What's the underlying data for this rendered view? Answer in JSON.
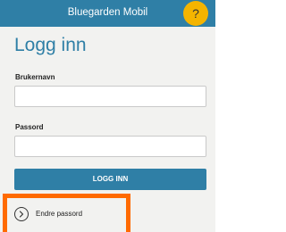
{
  "header": {
    "title": "Bluegarden Mobil",
    "help_label": "?"
  },
  "login": {
    "title": "Logg inn",
    "username_label": "Brukernavn",
    "username_value": "",
    "password_label": "Passord",
    "password_value": "",
    "submit_label": "LOGG INN",
    "change_password_label": "Endre passord"
  },
  "icons": {
    "help": "question-mark-icon",
    "change_password": "chevron-right-circle-icon"
  },
  "colors": {
    "brand_blue": "#2f7fa6",
    "help_yellow": "#f4b400",
    "panel_background": "#f2f2f0",
    "highlight_orange": "#ff6a00"
  }
}
